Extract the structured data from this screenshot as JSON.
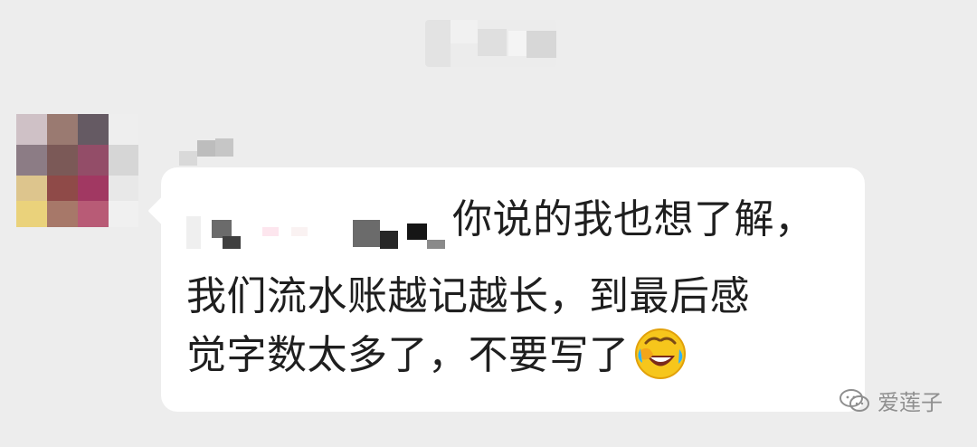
{
  "colors": {
    "background": "#ededed",
    "bubble": "#ffffff",
    "text": "#1f1f1f",
    "watermark": "#8f8f8f"
  },
  "message": {
    "line1": "你说的我也想了解，",
    "line2": "我们流水账越记越长，到最后感",
    "line3": "觉字数太多了，不要写了"
  },
  "emoji": {
    "name": "rofl-emoji-icon"
  },
  "watermark": {
    "text": "爱莲子",
    "icon": "wechat-icon"
  }
}
